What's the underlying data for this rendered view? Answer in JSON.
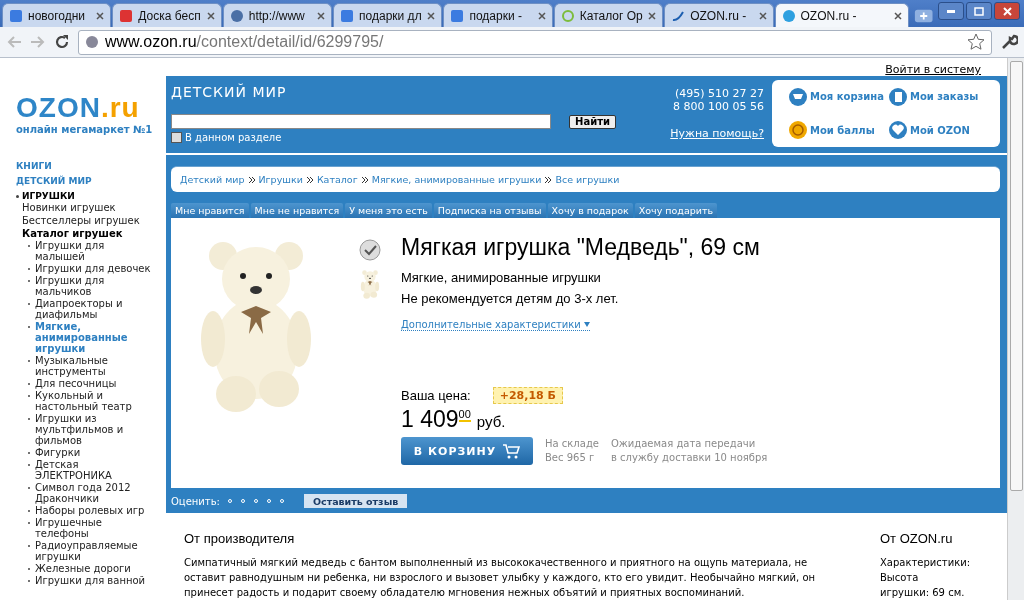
{
  "browser": {
    "tabs": [
      {
        "title": "новогодни",
        "selected": false
      },
      {
        "title": "Доска бесп",
        "selected": false
      },
      {
        "title": "http://www",
        "selected": false
      },
      {
        "title": "подарки дл",
        "selected": false
      },
      {
        "title": "подарки -",
        "selected": false
      },
      {
        "title": "Каталог Ор",
        "selected": false
      },
      {
        "title": "OZON.ru -",
        "selected": false
      },
      {
        "title": "OZON.ru -",
        "selected": true
      }
    ],
    "url": {
      "host": "www.ozon.ru",
      "path": "/context/detail/id/6299795/"
    }
  },
  "login_link": "Войти в систему",
  "logo": {
    "name": "OZON",
    "suffix": ".ru",
    "tagline": "онлайн мегамаркет №1"
  },
  "sidebar": {
    "items": [
      {
        "label": "КНИГИ",
        "kind": "top"
      },
      {
        "label": "ДЕТСКИЙ МИР",
        "kind": "top"
      },
      {
        "label": "ИГРУШКИ",
        "kind": "current",
        "children": [
          {
            "label": "Новинки игрушек",
            "kind": "sub"
          },
          {
            "label": "Бестселлеры игрушек",
            "kind": "sub"
          },
          {
            "label": "Каталог игрушек",
            "kind": "open",
            "children": [
              {
                "label": "Игрушки для малышей",
                "selected": false
              },
              {
                "label": "Игрушки для девочек",
                "selected": false
              },
              {
                "label": "Игрушки для мальчиков",
                "selected": false
              },
              {
                "label": "Диапроекторы и диафильмы",
                "selected": false
              },
              {
                "label": "Мягкие, анимированные игрушки",
                "selected": true
              },
              {
                "label": "Музыкальные инструменты",
                "selected": false
              },
              {
                "label": "Для песочницы",
                "selected": false
              },
              {
                "label": "Кукольный и настольный театр",
                "selected": false
              },
              {
                "label": "Игрушки из мультфильмов и фильмов",
                "selected": false
              },
              {
                "label": "Фигурки",
                "selected": false
              },
              {
                "label": "Детская ЭЛЕКТРОНИКА",
                "selected": false
              },
              {
                "label": "Символ года 2012 Дракончики",
                "selected": false
              },
              {
                "label": "Наборы ролевых игр",
                "selected": false
              },
              {
                "label": "Игрушечные телефоны",
                "selected": false
              },
              {
                "label": "Радиоуправляемые игрушки",
                "selected": false
              },
              {
                "label": "Железные дороги",
                "selected": false
              },
              {
                "label": "Игрушки для ванной",
                "selected": false
              }
            ]
          }
        ]
      }
    ]
  },
  "header": {
    "section_title": "ДЕТСКИЙ МИР",
    "search": {
      "button": "Найти",
      "scope_label": "В данном разделе",
      "scope_checked": false
    },
    "phones": [
      "(495) 510 27 27",
      "8 800 100 05 56"
    ],
    "help_link": "Нужна помощь?",
    "account_links": [
      "Моя корзина",
      "Мои заказы",
      "Мои баллы",
      "Мой OZON"
    ]
  },
  "breadcrumbs": [
    "Детский мир",
    "Игрушки",
    "Каталог",
    "Мягкие, анимированные игрушки",
    "Все игрушки"
  ],
  "actions": [
    "Мне нравится",
    "Мне не нравится",
    "У меня это есть",
    "Подписка на отзывы",
    "Хочу в подарок",
    "Хочу подарить"
  ],
  "product": {
    "title": "Мягкая игрушка \"Медведь\", 69 см",
    "category": "Мягкие, анимированные игрушки",
    "age_note": "Не рекомендуется детям до 3-х лет.",
    "more_link": "Дополнительные характеристики",
    "price_label": "Ваша цена:",
    "bonus": "+28,18 Б",
    "price": "1 409",
    "cents": "00",
    "currency": "руб.",
    "cart_button": "В КОРЗИНУ",
    "stock": [
      "На складе",
      "Вес 965 г"
    ],
    "delivery": [
      "Ожидаемая дата передачи",
      "в службу доставки 10 ноября"
    ]
  },
  "rating": {
    "label": "Оценить:",
    "button": "Оставить отзыв"
  },
  "description": {
    "heading": "От производителя",
    "text": "Симпатичный мягкий медведь с бантом выполненный из высококачественного и приятного на ощупь материала, не оставит равнодушным ни ребенка, ни взрослого и вызовет улыбку у каждого, кто его увидит. Необычайно мягкий, он принесет радость и подарит своему обладателю мгновения нежных объятий и приятных воспоминаний."
  },
  "ozon_note": {
    "heading": "От OZON.ru",
    "lines": [
      "Характеристики:",
      "Высота",
      "игрушки: 69 см."
    ]
  }
}
